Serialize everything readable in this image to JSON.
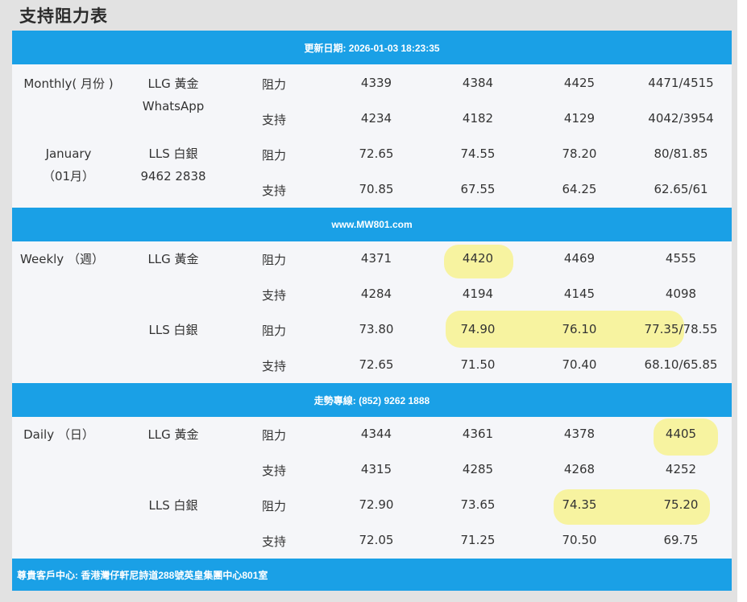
{
  "title": "支持阻力表",
  "bands": {
    "update": "更新日期: 2026-01-03 18:23:35",
    "site": "www.MW801.com",
    "hotline": "走勢專線: (852) 9262 1888",
    "address": "尊貴客戶中心: 香港灣仔軒尼詩道288號英皇集團中心801室"
  },
  "monthly": {
    "label_line1": "Monthly( 月份 )",
    "month_line1": "January",
    "month_line2": "（01月）",
    "gold_name": "LLG 黃金",
    "gold_contact": "WhatsApp",
    "silver_name": "LLS 白銀",
    "silver_contact": "9462 2838",
    "gold_res": {
      "type": "阻力",
      "v": [
        "4339",
        "4384",
        "4425",
        "4471/4515"
      ]
    },
    "gold_sup": {
      "type": "支持",
      "v": [
        "4234",
        "4182",
        "4129",
        "4042/3954"
      ]
    },
    "silver_res": {
      "type": "阻力",
      "v": [
        "72.65",
        "74.55",
        "78.20",
        "80/81.85"
      ]
    },
    "silver_sup": {
      "type": "支持",
      "v": [
        "70.85",
        "67.55",
        "64.25",
        "62.65/61"
      ]
    }
  },
  "weekly": {
    "label": "Weekly （週）",
    "gold_name": "LLG 黃金",
    "silver_name": "LLS 白銀",
    "gold_res": {
      "type": "阻力",
      "v": [
        "4371",
        "4420",
        "4469",
        "4555"
      ]
    },
    "gold_sup": {
      "type": "支持",
      "v": [
        "4284",
        "4194",
        "4145",
        "4098"
      ]
    },
    "silver_res": {
      "type": "阻力",
      "v": [
        "73.80",
        "74.90",
        "76.10",
        "77.35/78.55"
      ]
    },
    "silver_sup": {
      "type": "支持",
      "v": [
        "72.65",
        "71.50",
        "70.40",
        "68.10/65.85"
      ]
    }
  },
  "daily": {
    "label": "Daily （日）",
    "gold_name": "LLG 黃金",
    "silver_name": "LLS 白銀",
    "gold_res": {
      "type": "阻力",
      "v": [
        "4344",
        "4361",
        "4378",
        "4405"
      ]
    },
    "gold_sup": {
      "type": "支持",
      "v": [
        "4315",
        "4285",
        "4268",
        "4252"
      ]
    },
    "silver_res": {
      "type": "阻力",
      "v": [
        "72.90",
        "73.65",
        "74.35",
        "75.20"
      ]
    },
    "silver_sup": {
      "type": "支持",
      "v": [
        "72.05",
        "71.25",
        "70.50",
        "69.75"
      ]
    }
  },
  "colors": {
    "band": "#1aa0e6",
    "highlight": "#f7f3a0",
    "panel": "#e2e2e2"
  }
}
